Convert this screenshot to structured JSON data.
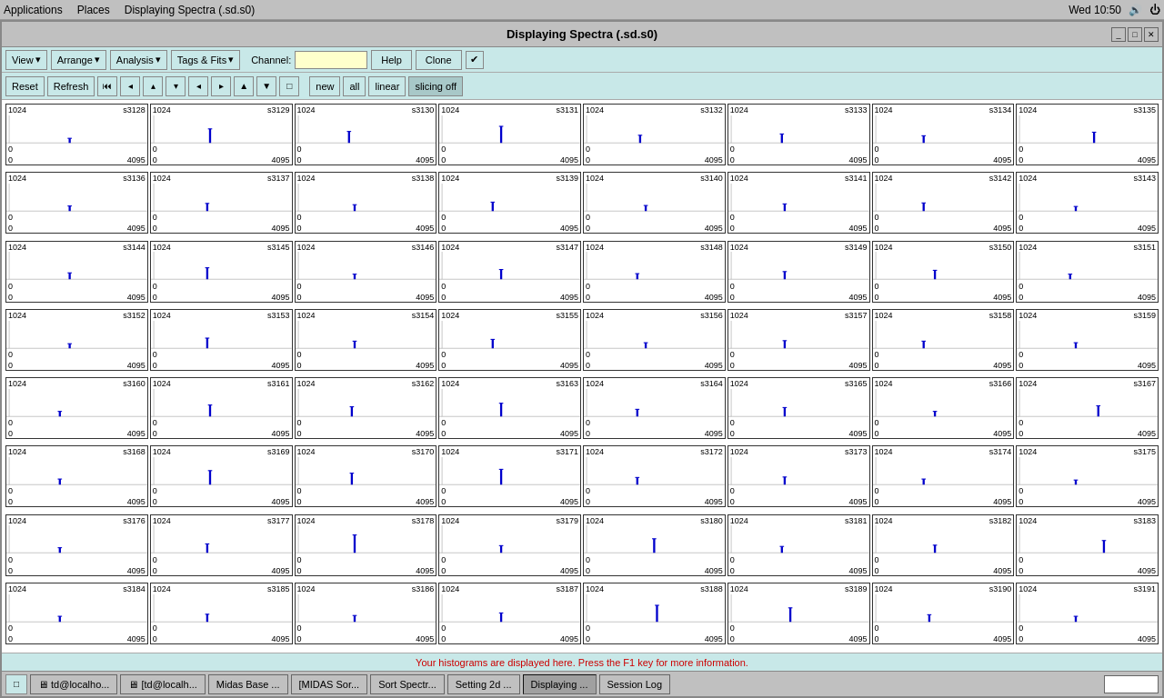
{
  "systemBar": {
    "appMenu": "Applications",
    "places": "Places",
    "windowTitle": "Displaying Spectra (.sd.s0)",
    "time": "Wed 10:50",
    "volumeIcon": "🔊"
  },
  "window": {
    "title": "Displaying Spectra (.sd.s0)",
    "minimizeLabel": "_",
    "maximizeLabel": "□",
    "closeLabel": "✕"
  },
  "menuBar": {
    "viewLabel": "View",
    "arrangeLabel": "Arrange",
    "analysisLabel": "Analysis",
    "tagsLabel": "Tags & Fits",
    "channelLabel": "Channel:",
    "channelValue": "",
    "helpLabel": "Help",
    "cloneLabel": "Clone",
    "checkboxChecked": true
  },
  "toolbar": {
    "resetLabel": "Reset",
    "refreshLabel": "Refresh",
    "newLabel": "new",
    "allLabel": "all",
    "linearLabel": "linear",
    "slicingOffLabel": "slicing off",
    "icons": [
      "⏮",
      "◀",
      "▲",
      "▼",
      "◁",
      "▷",
      "△",
      "▽",
      "□"
    ]
  },
  "statusBar": {
    "message": "Your histograms are displayed here. Press the F1 key for more information."
  },
  "spectra": {
    "yMax": "1024",
    "yMin": "0",
    "xMin": "0",
    "xMax": "4095",
    "cells": [
      {
        "id": "s3128",
        "peak": 0.18,
        "peakX": 0.45
      },
      {
        "id": "s3129",
        "peak": 0.55,
        "peakX": 0.42
      },
      {
        "id": "s3130",
        "peak": 0.45,
        "peakX": 0.38
      },
      {
        "id": "s3131",
        "peak": 0.65,
        "peakX": 0.44
      },
      {
        "id": "s3132",
        "peak": 0.3,
        "peakX": 0.4
      },
      {
        "id": "s3133",
        "peak": 0.35,
        "peakX": 0.38
      },
      {
        "id": "s3134",
        "peak": 0.28,
        "peakX": 0.36
      },
      {
        "id": "s3135",
        "peak": 0.42,
        "peakX": 0.55
      },
      {
        "id": "s3136",
        "peak": 0.2,
        "peakX": 0.45
      },
      {
        "id": "s3137",
        "peak": 0.3,
        "peakX": 0.4
      },
      {
        "id": "s3138",
        "peak": 0.25,
        "peakX": 0.42
      },
      {
        "id": "s3139",
        "peak": 0.35,
        "peakX": 0.38
      },
      {
        "id": "s3140",
        "peak": 0.22,
        "peakX": 0.44
      },
      {
        "id": "s3141",
        "peak": 0.28,
        "peakX": 0.4
      },
      {
        "id": "s3142",
        "peak": 0.32,
        "peakX": 0.36
      },
      {
        "id": "s3143",
        "peak": 0.18,
        "peakX": 0.42
      },
      {
        "id": "s3144",
        "peak": 0.25,
        "peakX": 0.45
      },
      {
        "id": "s3145",
        "peak": 0.45,
        "peakX": 0.4
      },
      {
        "id": "s3146",
        "peak": 0.2,
        "peakX": 0.42
      },
      {
        "id": "s3147",
        "peak": 0.38,
        "peakX": 0.44
      },
      {
        "id": "s3148",
        "peak": 0.22,
        "peakX": 0.38
      },
      {
        "id": "s3149",
        "peak": 0.3,
        "peakX": 0.4
      },
      {
        "id": "s3150",
        "peak": 0.35,
        "peakX": 0.44
      },
      {
        "id": "s3151",
        "peak": 0.2,
        "peakX": 0.38
      },
      {
        "id": "s3152",
        "peak": 0.18,
        "peakX": 0.45
      },
      {
        "id": "s3153",
        "peak": 0.4,
        "peakX": 0.4
      },
      {
        "id": "s3154",
        "peak": 0.28,
        "peakX": 0.42
      },
      {
        "id": "s3155",
        "peak": 0.35,
        "peakX": 0.38
      },
      {
        "id": "s3156",
        "peak": 0.22,
        "peakX": 0.44
      },
      {
        "id": "s3157",
        "peak": 0.3,
        "peakX": 0.4
      },
      {
        "id": "s3158",
        "peak": 0.28,
        "peakX": 0.36
      },
      {
        "id": "s3159",
        "peak": 0.22,
        "peakX": 0.42
      },
      {
        "id": "s3160",
        "peak": 0.2,
        "peakX": 0.38
      },
      {
        "id": "s3161",
        "peak": 0.45,
        "peakX": 0.42
      },
      {
        "id": "s3162",
        "peak": 0.38,
        "peakX": 0.4
      },
      {
        "id": "s3163",
        "peak": 0.52,
        "peakX": 0.44
      },
      {
        "id": "s3164",
        "peak": 0.28,
        "peakX": 0.38
      },
      {
        "id": "s3165",
        "peak": 0.35,
        "peakX": 0.4
      },
      {
        "id": "s3166",
        "peak": 0.2,
        "peakX": 0.44
      },
      {
        "id": "s3167",
        "peak": 0.42,
        "peakX": 0.58
      },
      {
        "id": "s3168",
        "peak": 0.22,
        "peakX": 0.38
      },
      {
        "id": "s3169",
        "peak": 0.55,
        "peakX": 0.42
      },
      {
        "id": "s3170",
        "peak": 0.45,
        "peakX": 0.4
      },
      {
        "id": "s3171",
        "peak": 0.6,
        "peakX": 0.44
      },
      {
        "id": "s3172",
        "peak": 0.28,
        "peakX": 0.38
      },
      {
        "id": "s3173",
        "peak": 0.3,
        "peakX": 0.4
      },
      {
        "id": "s3174",
        "peak": 0.22,
        "peakX": 0.36
      },
      {
        "id": "s3175",
        "peak": 0.18,
        "peakX": 0.42
      },
      {
        "id": "s3176",
        "peak": 0.2,
        "peakX": 0.38
      },
      {
        "id": "s3177",
        "peak": 0.35,
        "peakX": 0.4
      },
      {
        "id": "s3178",
        "peak": 0.7,
        "peakX": 0.42
      },
      {
        "id": "s3179",
        "peak": 0.28,
        "peakX": 0.44
      },
      {
        "id": "s3180",
        "peak": 0.55,
        "peakX": 0.5
      },
      {
        "id": "s3181",
        "peak": 0.25,
        "peakX": 0.38
      },
      {
        "id": "s3182",
        "peak": 0.3,
        "peakX": 0.44
      },
      {
        "id": "s3183",
        "peak": 0.48,
        "peakX": 0.62
      },
      {
        "id": "s3184",
        "peak": 0.22,
        "peakX": 0.38
      },
      {
        "id": "s3185",
        "peak": 0.3,
        "peakX": 0.4
      },
      {
        "id": "s3186",
        "peak": 0.25,
        "peakX": 0.42
      },
      {
        "id": "s3187",
        "peak": 0.35,
        "peakX": 0.44
      },
      {
        "id": "s3188",
        "peak": 0.65,
        "peakX": 0.52
      },
      {
        "id": "s3189",
        "peak": 0.55,
        "peakX": 0.44
      },
      {
        "id": "s3190",
        "peak": 0.28,
        "peakX": 0.4
      },
      {
        "id": "s3191",
        "peak": 0.22,
        "peakX": 0.42
      }
    ]
  },
  "taskbar": {
    "items": [
      {
        "label": "td@localho...",
        "active": false,
        "icon": "🖥"
      },
      {
        "label": "[td@localh...",
        "active": false,
        "icon": "🖥"
      },
      {
        "label": "Midas Base ...",
        "active": false
      },
      {
        "label": "[MIDAS Sor...",
        "active": false
      },
      {
        "label": "Sort Spectr...",
        "active": false
      },
      {
        "label": "Setting 2d ...",
        "active": false
      },
      {
        "label": "Displaying ...",
        "active": true
      },
      {
        "label": "Session Log",
        "active": false
      }
    ]
  }
}
